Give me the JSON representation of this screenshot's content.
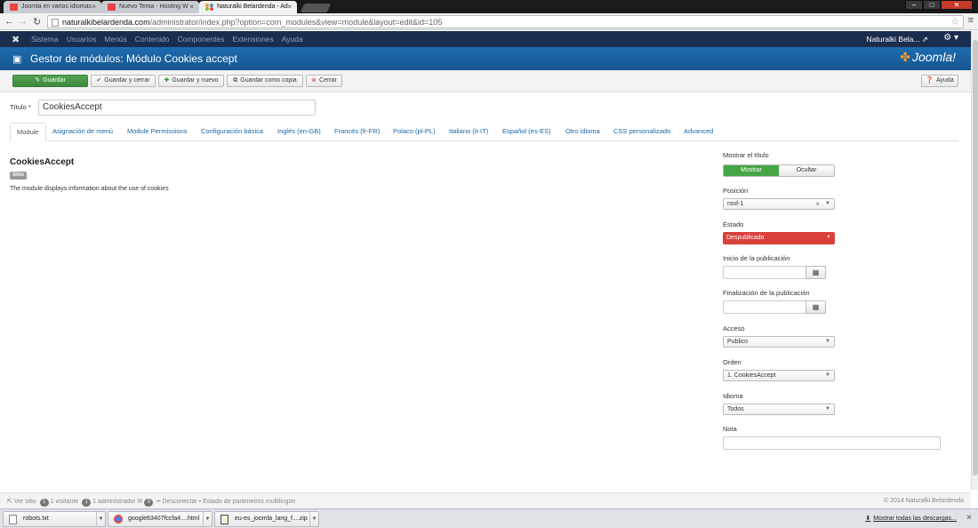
{
  "browser": {
    "tabs": [
      {
        "title": "Joomla en varios idiomas"
      },
      {
        "title": "Nuevo Tema - Hosting W"
      },
      {
        "title": "Naturalki Belardenda - Ad"
      }
    ],
    "url_host": "naturalkibelardenda.com",
    "url_path": "/administrator/index.php?option=com_modules&view=module&layout=edit&id=105"
  },
  "joomla_nav": {
    "items": [
      "Sistema",
      "Usuarios",
      "Menús",
      "Contenido",
      "Componentes",
      "Extensiones",
      "Ayuda"
    ],
    "user": "Naturalki Bela..."
  },
  "header": {
    "title": "Gestor de módulos: Módulo Cookies accept",
    "brand": "Joomla!"
  },
  "toolbar": {
    "save": "Guardar",
    "save_close": "Guardar y cerrar",
    "save_new": "Guardar y nuevo",
    "save_copy": "Guardar como copia",
    "close": "Cerrar",
    "help": "Ayuda"
  },
  "form": {
    "title_label": "Título *",
    "title_value": "CookiesAccept"
  },
  "tabs": [
    "Module",
    "Asignación de menú",
    "Module Permissions",
    "Configuración básica",
    "Inglés (en-GB)",
    "Francés (fr-FR)",
    "Polaco (pl-PL)",
    "Italiano (it-IT)",
    "Español (es-ES)",
    "Otro idioma",
    "CSS personalizado",
    "Advanced"
  ],
  "module": {
    "name": "CookiesAccept",
    "badge": "Sitio",
    "description": "The module displays information about the use of cookies"
  },
  "options": {
    "show_title_label": "Mostrar el título",
    "show_label": "Mostrar",
    "hide_label": "Ocultar",
    "position_label": "Posición",
    "position_value": "roof-1",
    "state_label": "Estado",
    "state_value": "Despublicado",
    "publish_up_label": "Inicio de la publicación",
    "publish_down_label": "Finalización de la publicación",
    "access_label": "Acceso",
    "access_value": "Publico",
    "order_label": "Orden",
    "order_value": "1. CookiesAccept",
    "language_label": "Idioma",
    "language_value": "Todos",
    "note_label": "Nota"
  },
  "statusbar": {
    "view_site": "Ver sitio",
    "visitors_count": "1",
    "visitors_label": "1 visitante",
    "admins_count": "1",
    "admins_label": "1 administrador",
    "messages_count": "0",
    "logout": "Desconectar",
    "multilang": "Estado de parámetros multilingüe",
    "copyright": "© 2014 Naturalki Belardenda"
  },
  "downloads": {
    "items": [
      "robots.txt",
      "google63407fccfa4....html",
      "eu-es_joomla_lang_f....zip"
    ],
    "show_all": "Mostrar todas las descargas..."
  },
  "colors": {
    "nav_bg": "#1b2d4e",
    "header_bg": "#1d6cb0",
    "save_green": "#46a546",
    "unpublished_red": "#d9403b",
    "link_blue": "#1a66a8"
  }
}
